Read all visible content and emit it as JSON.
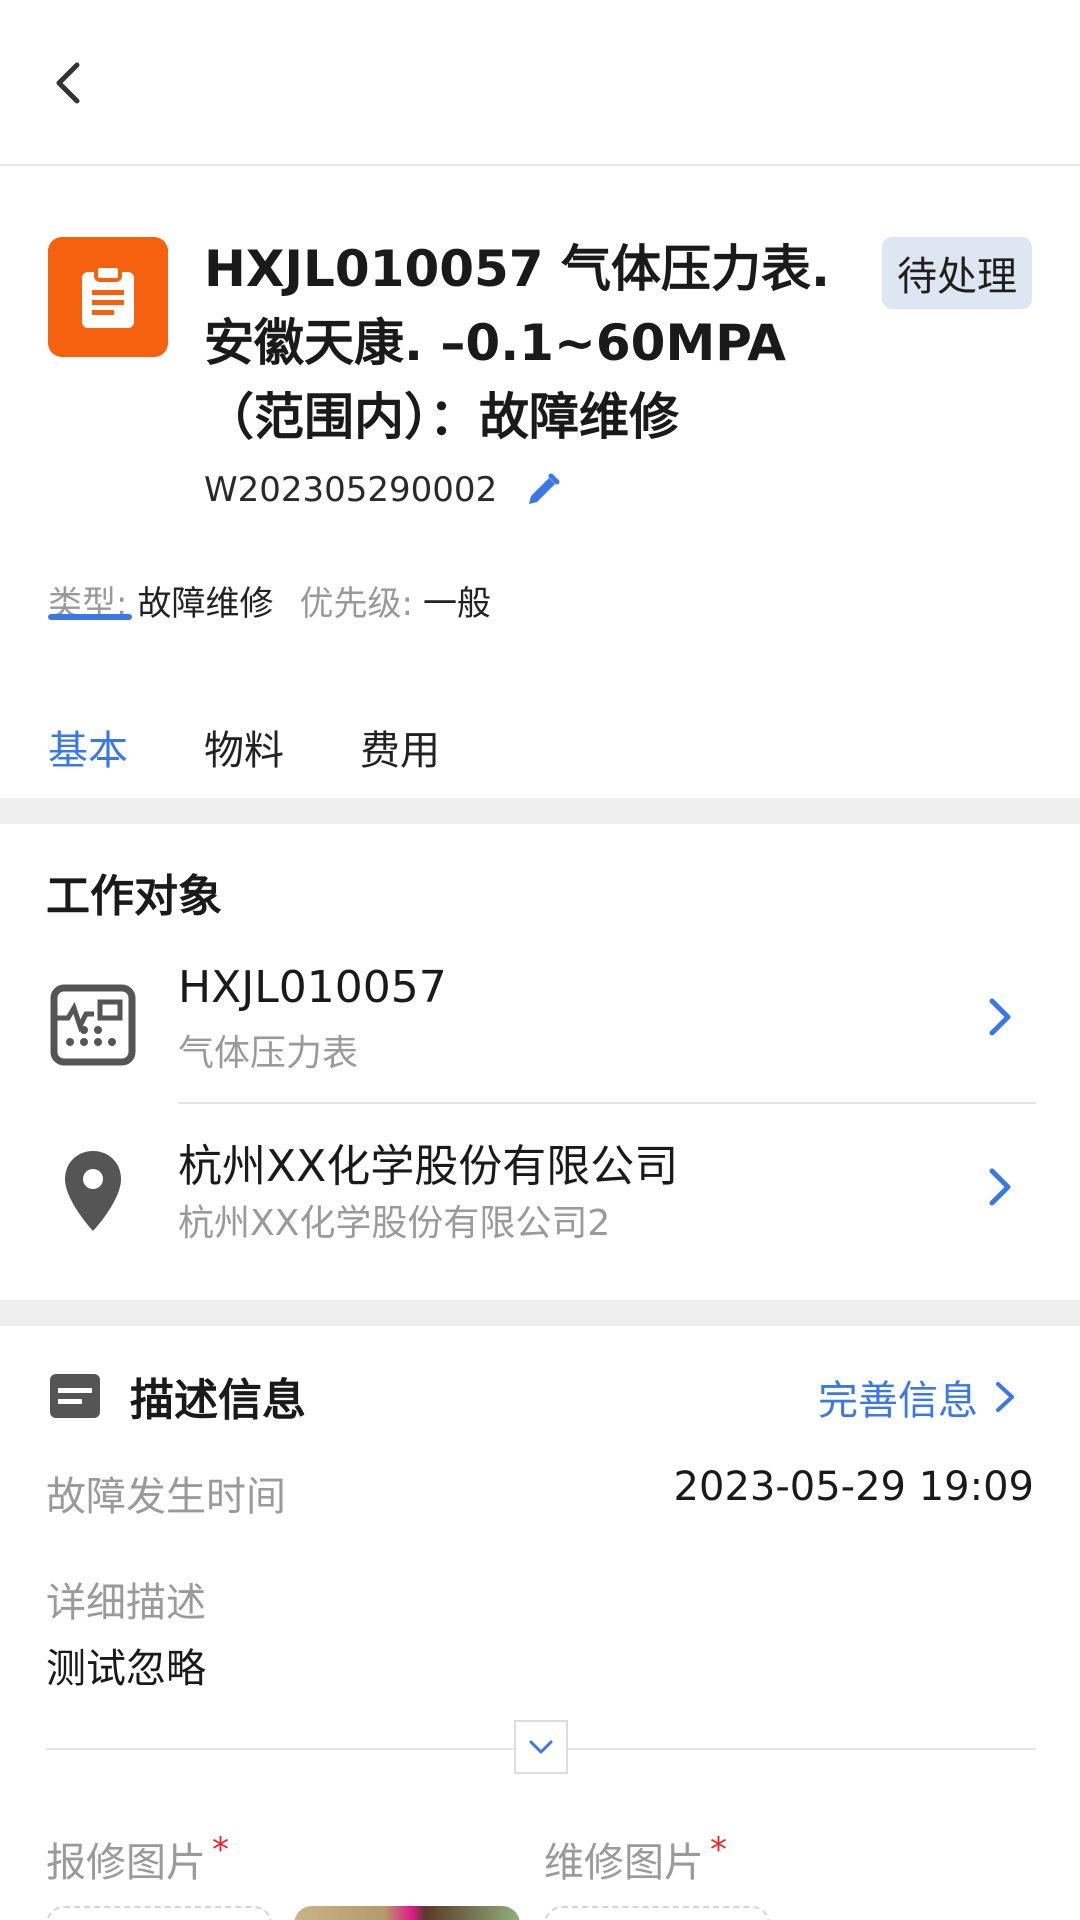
{
  "order": {
    "title": "HXJL010057 气体压力表. 安徽天康. –0.1~60MPA （范围内）：故障维修",
    "status": "待处理",
    "number": "W202305290002"
  },
  "meta": {
    "type_label": "类型:",
    "type_value": "故障维修",
    "priority_label": "优先级:",
    "priority_value": "一般"
  },
  "tabs": [
    {
      "label": "基本",
      "active": true
    },
    {
      "label": "物料",
      "active": false
    },
    {
      "label": "费用",
      "active": false
    }
  ],
  "work_object": {
    "section_title": "工作对象",
    "items": [
      {
        "title": "HXJL010057",
        "subtitle": "气体压力表",
        "icon": "device-icon"
      },
      {
        "title": "杭州XX化学股份有限公司",
        "subtitle": "杭州XX化学股份有限公司2",
        "icon": "location-pin-icon"
      }
    ]
  },
  "description": {
    "section_title": "描述信息",
    "complete_link": "完善信息",
    "fault_time_label": "故障发生时间",
    "fault_time_value": "2023-05-29 19:09",
    "detail_label": "详细描述",
    "detail_value": "测试忽略"
  },
  "images": {
    "report_label": "报修图片",
    "repair_label": "维修图片",
    "required_mark": "*"
  },
  "colors": {
    "accent": "#3b78e7",
    "order_icon_bg": "#f5610f",
    "status_badge_bg": "#dde6f1",
    "required": "#e3262f"
  }
}
